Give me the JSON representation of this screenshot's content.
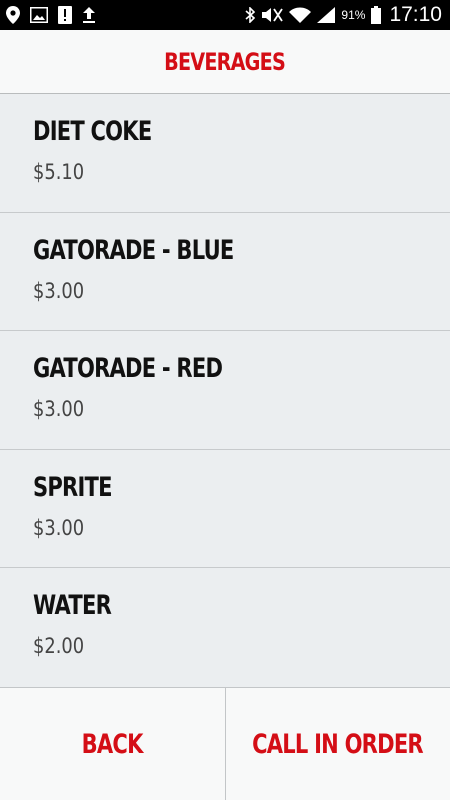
{
  "status_bar": {
    "battery_percent": "91%",
    "time": "17:10",
    "left_icons": [
      "location-icon",
      "image-icon",
      "alert-icon",
      "upload-icon"
    ],
    "right_icons": [
      "bluetooth-icon",
      "mute-icon",
      "wifi-icon",
      "signal-icon",
      "battery-icon"
    ]
  },
  "header": {
    "title": "BEVERAGES"
  },
  "menu": {
    "items": [
      {
        "name": "DIET COKE",
        "price": "$5.10"
      },
      {
        "name": "GATORADE - BLUE",
        "price": "$3.00"
      },
      {
        "name": "GATORADE - RED",
        "price": "$3.00"
      },
      {
        "name": "SPRITE",
        "price": "$3.00"
      },
      {
        "name": "WATER",
        "price": "$2.00"
      }
    ]
  },
  "footer": {
    "back_label": "BACK",
    "call_label": "CALL IN ORDER"
  },
  "colors": {
    "accent": "#d40e16",
    "list_background": "#ebeef0",
    "status_bar": "#000000"
  }
}
